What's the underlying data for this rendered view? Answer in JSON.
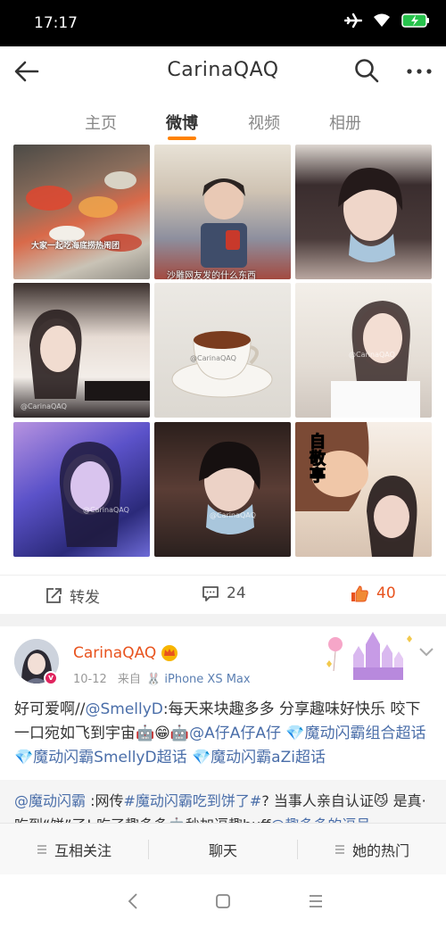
{
  "status_bar": {
    "time": "17:17"
  },
  "header": {
    "title": "CarinaQAQ"
  },
  "tabs": [
    {
      "label": "主页"
    },
    {
      "label": "微博"
    },
    {
      "label": "视频"
    },
    {
      "label": "相册"
    }
  ],
  "post1": {
    "photo_overlay_text_1": "大家一起吃海底捞热闹团",
    "photo_overlay_text_2": "沙雕网友发的什么东西",
    "photo_overlay_text_9": "自敬亭",
    "watermark": "@CarinaQAQ",
    "actions": {
      "repost_label": "转发",
      "comment_count": "24",
      "like_count": "40"
    }
  },
  "post2": {
    "username": "CarinaQAQ",
    "avatar_badge": "v",
    "date": "10-12",
    "from_label": "来自",
    "device": "iPhone XS Max",
    "text_segments": [
      {
        "t": "好可爱啊//",
        "link": false
      },
      {
        "t": "@SmellyD",
        "link": true
      },
      {
        "t": ":每天来块趣多多 分享趣味好快乐 咬下一口宛如飞到宇宙🤖😁🤖",
        "link": false
      },
      {
        "t": "@A仔A仔A仔",
        "link": true
      },
      {
        "t": " ",
        "link": false
      },
      {
        "t": "💎魔动闪霸组合超话",
        "link": true
      },
      {
        "t": " ",
        "link": false
      },
      {
        "t": "💎魔动闪霸SmellyD超话",
        "link": true
      },
      {
        "t": " ",
        "link": false
      },
      {
        "t": "💎魔动闪霸aZi超话",
        "link": true
      }
    ],
    "repost_segments": [
      {
        "t": "@魔动闪霸",
        "link": true
      },
      {
        "t": " :网传",
        "link": false
      },
      {
        "t": "#魔动闪霸吃到饼了#",
        "link": true
      },
      {
        "t": "? 当事人亲自认证😼 是真·吃到“饼”了! 吃了趣多多🤖秒加逗趣buff",
        "link": false
      },
      {
        "t": "@趣多多的逗号",
        "link": true
      },
      {
        "t": " .",
        "link": false
      }
    ]
  },
  "bottom_bar": [
    {
      "label": "互相关注"
    },
    {
      "label": "聊天"
    },
    {
      "label": "她的热门"
    }
  ],
  "colors": {
    "accent": "#ff8200",
    "link": "#4a6ea9",
    "username": "#e8531e",
    "like": "#e8531e"
  },
  "icons": [
    "back-arrow-icon",
    "search-icon",
    "more-icon",
    "repost-icon",
    "comment-icon",
    "like-icon",
    "crown-icon",
    "chevron-down-icon",
    "menu-lines-icon"
  ]
}
